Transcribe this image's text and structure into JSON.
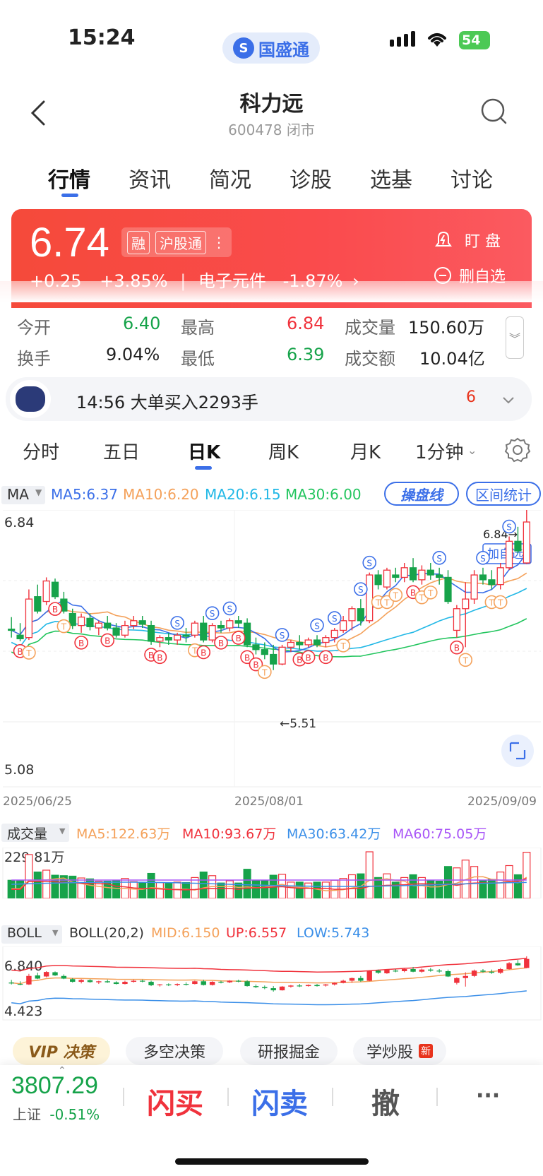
{
  "status_bar": {
    "time": "15:24",
    "app_pill": "国盛通",
    "battery": "54"
  },
  "header": {
    "title": "科力远",
    "subtitle": "600478 闭市"
  },
  "tabs": [
    "行情",
    "资讯",
    "简况",
    "诊股",
    "选基",
    "讨论"
  ],
  "quote": {
    "price": "6.74",
    "tags": [
      "融",
      "沪股通"
    ],
    "change": "+0.25",
    "change_pct": "+3.85%",
    "sector": "电子元件",
    "sector_pct": "-1.87%",
    "watch_label": "盯 盘",
    "delete_label": "删自选"
  },
  "stats": {
    "open_label": "今开",
    "open": "6.40",
    "high_label": "最高",
    "high": "6.84",
    "volume_label": "成交量",
    "volume": "150.60万",
    "turnover_label": "换手",
    "turnover": "9.04%",
    "low_label": "最低",
    "low": "6.39",
    "amount_label": "成交额",
    "amount": "10.04亿"
  },
  "big_order": {
    "text": "14:56 大单买入2293手",
    "count": "6"
  },
  "kline_tabs": [
    "分时",
    "五日",
    "日K",
    "周K",
    "月K",
    "1分钟"
  ],
  "ma_legend": {
    "label": "MA",
    "ma5": "MA5:6.37",
    "ma10": "MA10:6.20",
    "ma20": "MA20:6.15",
    "ma30": "MA30:6.00",
    "btn1": "操盘线",
    "btn2": "区间统计"
  },
  "chart_text": {
    "y_top": "6.84",
    "y_bottom": "5.08",
    "high_mark": "6.84→",
    "low_mark": "←5.51",
    "add_fav": "加自选",
    "x_dates": [
      "2025/06/25",
      "2025/08/01",
      "2025/09/09"
    ]
  },
  "volume_legend": {
    "label": "成交量",
    "ma5": "MA5:122.63万",
    "ma10": "MA10:93.67万",
    "ma30": "MA30:63.42万",
    "ma60": "MA60:75.05万",
    "top": "229.81万"
  },
  "boll_legend": {
    "label": "BOLL",
    "param": "BOLL(20,2)",
    "mid": "MID:6.150",
    "up": "UP:6.557",
    "low": "LOW:5.743",
    "top": "6.840",
    "bottom": "4.423"
  },
  "bottom_tabs": [
    "VIP 决策",
    "多空决策",
    "研报掘金",
    "学炒股"
  ],
  "new_badge": "新",
  "footer": {
    "index": "3807.29",
    "index_name": "上证",
    "index_pct": "-0.51%",
    "buy": "闪买",
    "sell": "闪卖",
    "cancel": "撤",
    "more": "···"
  },
  "colors": {
    "up": "#f0323c",
    "down": "#16a34a",
    "accent": "#3b6fe8",
    "ma5": "#3b6fe8",
    "ma10": "#f4a15a",
    "ma20": "#22b8e6",
    "ma30": "#22c55e"
  },
  "chart_data": [
    {
      "type": "candlestick",
      "title": "日K",
      "x_range": [
        "2025/06/25",
        "2025/09/09"
      ],
      "ylim": [
        5.08,
        6.84
      ],
      "ohlc_approx": [
        [
          5.85,
          5.95,
          5.78,
          5.84
        ],
        [
          5.8,
          5.9,
          5.75,
          5.77
        ],
        [
          5.78,
          6.18,
          5.76,
          6.1
        ],
        [
          6.12,
          6.22,
          5.98,
          6.0
        ],
        [
          6.08,
          6.28,
          6.05,
          6.25
        ],
        [
          6.24,
          6.27,
          6.1,
          6.12
        ],
        [
          6.1,
          6.16,
          5.98,
          6.0
        ],
        [
          5.98,
          6.02,
          5.85,
          5.88
        ],
        [
          5.88,
          5.98,
          5.82,
          5.95
        ],
        [
          5.94,
          5.98,
          5.84,
          5.87
        ],
        [
          5.86,
          5.92,
          5.8,
          5.9
        ],
        [
          5.9,
          5.96,
          5.84,
          5.86
        ],
        [
          5.86,
          5.9,
          5.78,
          5.8
        ],
        [
          5.8,
          5.92,
          5.78,
          5.88
        ],
        [
          5.88,
          5.96,
          5.85,
          5.92
        ],
        [
          5.92,
          5.96,
          5.86,
          5.89
        ],
        [
          5.88,
          5.92,
          5.72,
          5.75
        ],
        [
          5.75,
          5.8,
          5.7,
          5.78
        ],
        [
          5.78,
          5.82,
          5.72,
          5.76
        ],
        [
          5.76,
          5.82,
          5.72,
          5.8
        ],
        [
          5.8,
          5.86,
          5.74,
          5.79
        ],
        [
          5.8,
          5.92,
          5.78,
          5.9
        ],
        [
          5.9,
          5.96,
          5.74,
          5.76
        ],
        [
          5.76,
          5.9,
          5.74,
          5.88
        ],
        [
          5.88,
          5.92,
          5.82,
          5.86
        ],
        [
          5.86,
          5.94,
          5.83,
          5.92
        ],
        [
          5.92,
          5.96,
          5.86,
          5.9
        ],
        [
          5.9,
          5.94,
          5.7,
          5.72
        ],
        [
          5.72,
          5.78,
          5.64,
          5.68
        ],
        [
          5.68,
          5.74,
          5.6,
          5.64
        ],
        [
          5.64,
          5.72,
          5.51,
          5.56
        ],
        [
          5.56,
          5.72,
          5.55,
          5.7
        ],
        [
          5.7,
          5.76,
          5.66,
          5.74
        ],
        [
          5.74,
          5.8,
          5.68,
          5.72
        ],
        [
          5.72,
          5.78,
          5.7,
          5.76
        ],
        [
          5.76,
          5.8,
          5.7,
          5.72
        ],
        [
          5.74,
          5.8,
          5.7,
          5.78
        ],
        [
          5.78,
          5.86,
          5.74,
          5.84
        ],
        [
          5.84,
          5.96,
          5.82,
          5.92
        ],
        [
          5.92,
          6.04,
          5.84,
          6.02
        ],
        [
          6.02,
          6.1,
          5.88,
          5.92
        ],
        [
          5.92,
          6.32,
          5.9,
          6.3
        ],
        [
          6.3,
          6.34,
          6.18,
          6.22
        ],
        [
          6.2,
          6.36,
          6.18,
          6.34
        ],
        [
          6.3,
          6.36,
          6.24,
          6.28
        ],
        [
          6.28,
          6.4,
          6.24,
          6.36
        ],
        [
          6.36,
          6.44,
          6.24,
          6.26
        ],
        [
          6.26,
          6.38,
          6.22,
          6.34
        ],
        [
          6.34,
          6.4,
          6.26,
          6.3
        ],
        [
          6.3,
          6.36,
          6.22,
          6.28
        ],
        [
          6.28,
          6.34,
          6.06,
          6.08
        ],
        [
          5.84,
          6.05,
          5.78,
          6.02
        ],
        [
          6.02,
          6.24,
          5.7,
          6.1
        ],
        [
          6.1,
          6.34,
          6.06,
          6.3
        ],
        [
          6.3,
          6.36,
          6.22,
          6.26
        ],
        [
          6.26,
          6.34,
          6.18,
          6.22
        ],
        [
          6.22,
          6.4,
          6.18,
          6.36
        ],
        [
          6.36,
          6.62,
          6.34,
          6.58
        ],
        [
          6.58,
          6.7,
          6.48,
          6.5
        ],
        [
          6.4,
          6.84,
          6.39,
          6.74
        ]
      ],
      "series": [
        {
          "name": "MA5",
          "last": 6.37
        },
        {
          "name": "MA10",
          "last": 6.2
        },
        {
          "name": "MA20",
          "last": 6.15
        },
        {
          "name": "MA30",
          "last": 6.0
        }
      ]
    }
  ]
}
